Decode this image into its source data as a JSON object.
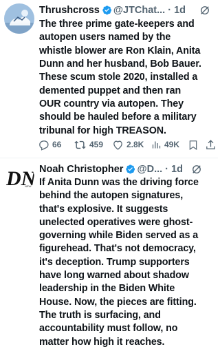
{
  "tweets": [
    {
      "name": "Thrushcross",
      "handle": "@JTChat...",
      "time": "1d",
      "text": "The three prime gate-keepers and\nautopen users named by the\nwhistle blower are Ron Klain, Anita\nDunn and her husband, Bob Bauer.\nThese scum stole 2020, installed a\ndemented puppet and then ran\nOUR country via autopen. They\nshould be hauled before a military\ntribunal for high TREASON.",
      "replies": "66",
      "reposts": "459",
      "likes": "2.8K",
      "views": "49K"
    },
    {
      "name": "Noah Christopher",
      "handle": "@D...",
      "time": "1d",
      "text": "If Anita Dunn was the driving force\nbehind the autopen signatures,\nthat's explosive. It suggests\nunelected operatives were ghost-\ngoverning while Biden served as a\nfigurehead. That's not democracy,\nit's deception. Trump supporters\nhave long warned about shadow\nleadership in the Biden White\nHouse. Now, the pieces are fitting.\nThe truth is surfacing, and\naccountability must follow, no\nmatter how high it reaches.",
      "avatar_logo": "DN",
      "avatar_small": "NEWS"
    }
  ],
  "colors": {
    "verified": "#1d9bf0",
    "secondary": "#536471",
    "text": "#0f1419"
  }
}
